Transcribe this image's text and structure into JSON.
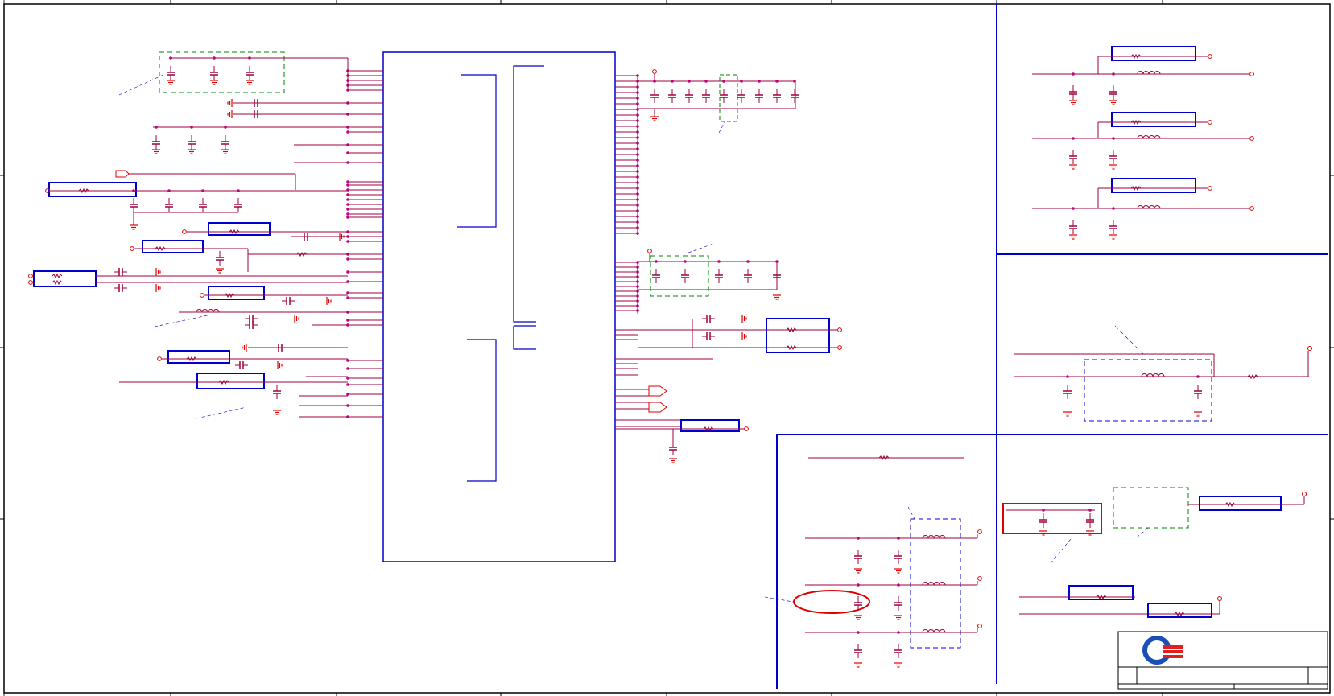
{
  "sheet": {
    "type": "schematic",
    "frame_border_color": "#000000",
    "wire_color": "#a0003c",
    "pin_color": "#c00080",
    "block_outline_color": "#0000cc",
    "highlight_red": "#e00000",
    "group_green": "#008000",
    "group_blue": "#0000cc",
    "sections": [
      "main-controller",
      "top-right-filter-bank",
      "right-middle-filter",
      "bottom-center-lc-filters",
      "bottom-right-passives"
    ]
  },
  "logo": {
    "icon": "company-logo-icon",
    "primary_color": "#1a4fb5",
    "accent_color": "#e0201c"
  }
}
